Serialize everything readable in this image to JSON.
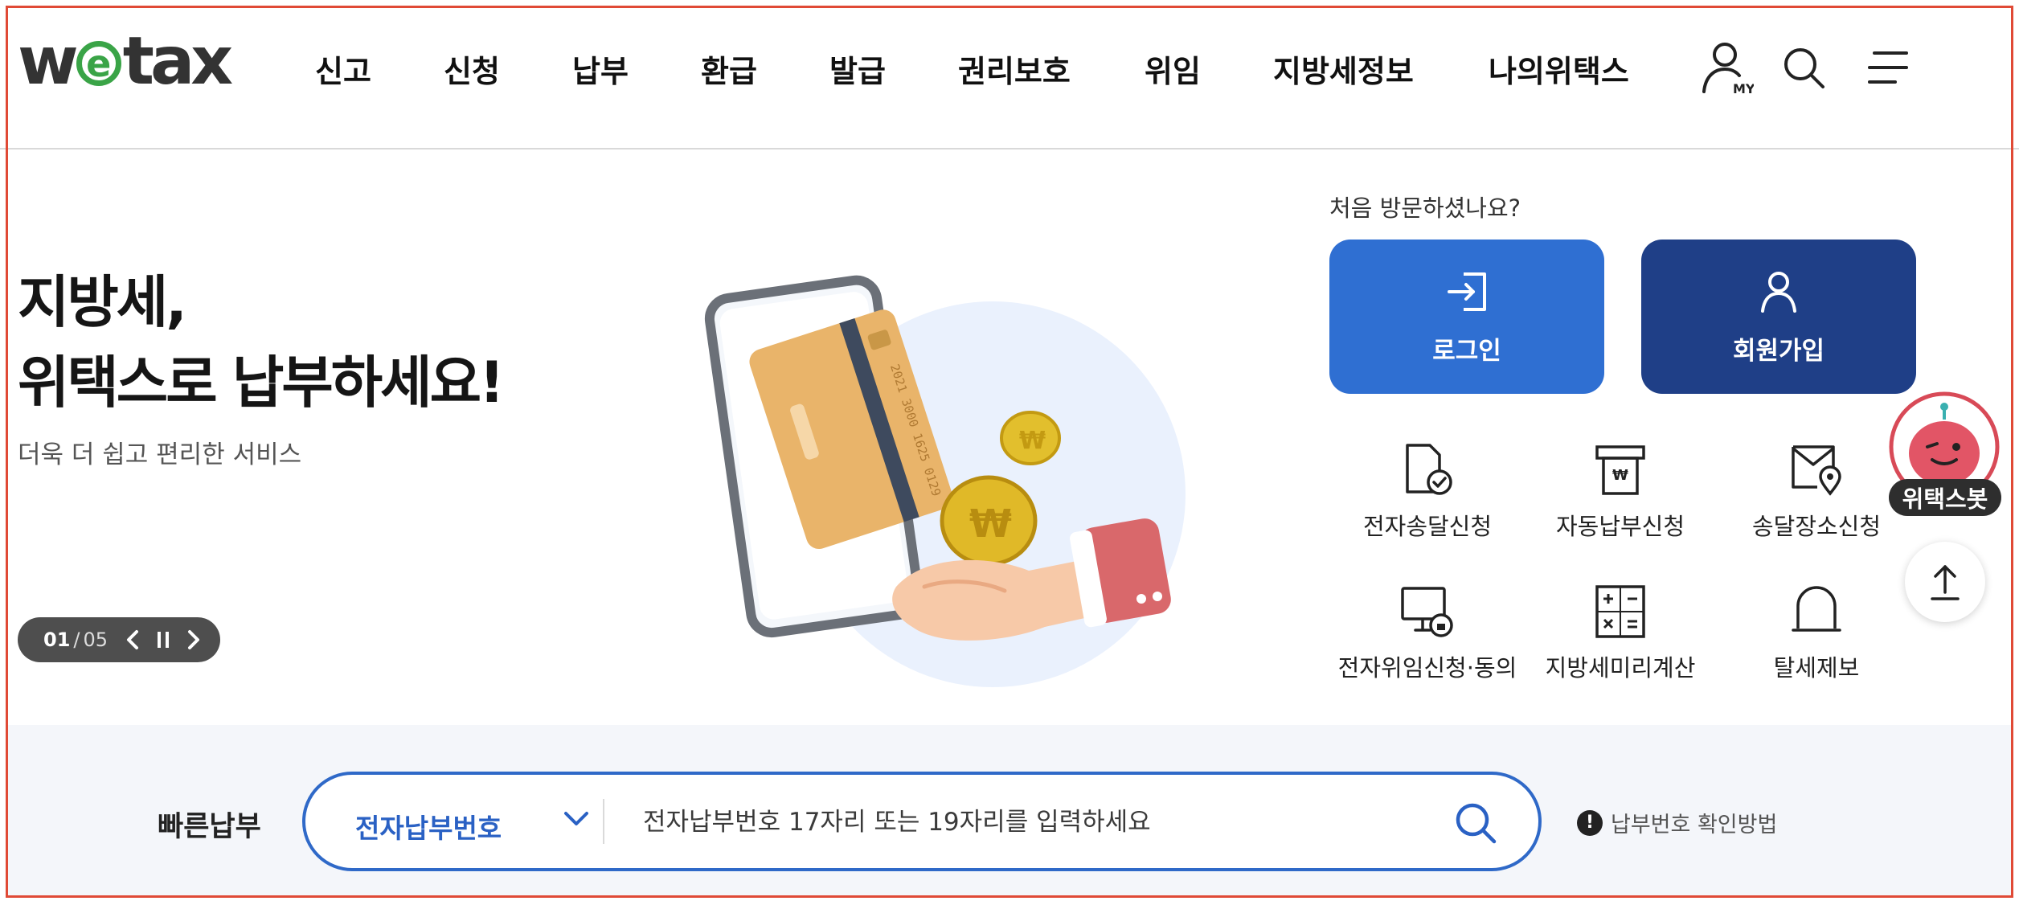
{
  "header": {
    "logo": {
      "pre": "w",
      "circle": "e",
      "post": "tax"
    },
    "nav": [
      "신고",
      "신청",
      "납부",
      "환급",
      "발급",
      "권리보호",
      "위임",
      "지방세정보",
      "나의위택스"
    ],
    "icons": {
      "my": "user-icon",
      "my_badge": "MY",
      "search": "search-icon",
      "menu": "menu-icon"
    }
  },
  "hero": {
    "title_line1": "지방세,",
    "title_line2": "위택스로 납부하세요!",
    "subtitle": "더욱 더 쉽고 편리한 서비스",
    "slider": {
      "current": "01",
      "sep": "/",
      "total": "05"
    },
    "illustration": {
      "card_number": "2021 3000 1625 0129"
    }
  },
  "account": {
    "prompt": "처음 방문하셨나요?",
    "login_label": "로그인",
    "join_label": "회원가입"
  },
  "services": [
    {
      "label": "전자송달신청",
      "icon": "document-check-icon"
    },
    {
      "label": "자동납부신청",
      "icon": "auto-pay-icon"
    },
    {
      "label": "송달장소신청",
      "icon": "location-envelope-icon"
    },
    {
      "label": "전자위임신청·동의",
      "icon": "monitor-lock-icon"
    },
    {
      "label": "지방세미리계산",
      "icon": "calculator-icon"
    },
    {
      "label": "탈세제보",
      "icon": "bell-icon"
    }
  ],
  "floating": {
    "bot_label": "위택스봇",
    "top_icon": "arrow-up-icon"
  },
  "quick_pay": {
    "label": "빠른납부",
    "select_value": "전자납부번호",
    "placeholder": "전자납부번호 17자리 또는 19자리를 입력하세요",
    "help": "납부번호 확인방법",
    "help_glyph": "!"
  },
  "colors": {
    "primary": "#2f6fd2",
    "navy": "#1f3f87",
    "logo_green": "#3aa447",
    "frame": "#e04a36"
  }
}
